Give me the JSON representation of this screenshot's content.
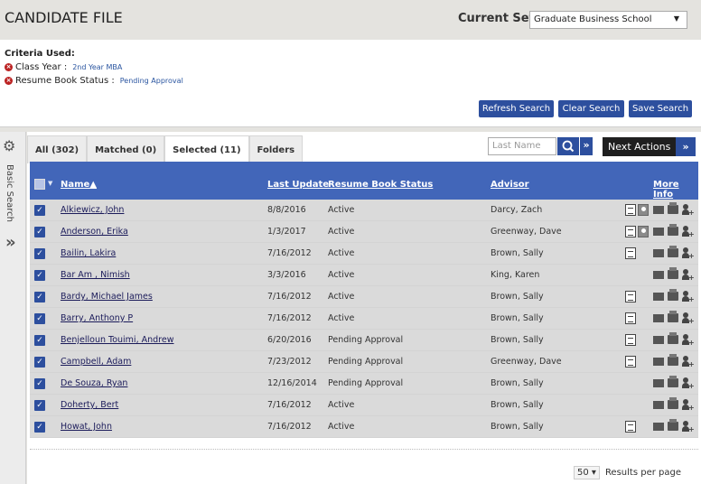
{
  "header": {
    "title": "CANDIDATE FILE",
    "current_set_label": "Current Set:",
    "current_set_value": "Graduate Business School"
  },
  "criteria": {
    "title": "Criteria Used:",
    "items": [
      {
        "label": "Class Year :",
        "value": "2nd Year MBA"
      },
      {
        "label": "Resume Book Status :",
        "value": "Pending Approval"
      }
    ],
    "buttons": {
      "refresh": "Refresh Search",
      "clear": "Clear Search",
      "save": "Save Search"
    }
  },
  "sidebar": {
    "label": "Basic Search"
  },
  "tabs": [
    {
      "label": "All (302)"
    },
    {
      "label": "Matched (0)"
    },
    {
      "label": "Selected (11)"
    },
    {
      "label": "Folders"
    }
  ],
  "toolbar": {
    "search_placeholder": "Last Name",
    "next_actions": "Next Actions"
  },
  "table": {
    "headers": {
      "name": "Name▲",
      "last_update": "Last Update",
      "status": "Resume Book Status",
      "advisor": "Advisor",
      "more_info": "More Info"
    },
    "rows": [
      {
        "name": "Alkiewicz, John",
        "last_update": "8/8/2016",
        "status": "Active",
        "advisor": "Darcy, Zach",
        "resume": true,
        "photo": true
      },
      {
        "name": "Anderson, Erika",
        "last_update": "1/3/2017",
        "status": "Active",
        "advisor": "Greenway, Dave",
        "resume": true,
        "photo": true
      },
      {
        "name": "Bailin, Lakira",
        "last_update": "7/16/2012",
        "status": "Active",
        "advisor": "Brown, Sally",
        "resume": true,
        "photo": false
      },
      {
        "name": "Bar Am , Nimish",
        "last_update": "3/3/2016",
        "status": "Active",
        "advisor": "King, Karen",
        "resume": false,
        "photo": false
      },
      {
        "name": "Bardy, Michael James",
        "last_update": "7/16/2012",
        "status": "Active",
        "advisor": "Brown, Sally",
        "resume": true,
        "photo": false
      },
      {
        "name": "Barry, Anthony P",
        "last_update": "7/16/2012",
        "status": "Active",
        "advisor": "Brown, Sally",
        "resume": true,
        "photo": false
      },
      {
        "name": "Benjelloun Touimi, Andrew",
        "last_update": "6/20/2016",
        "status": "Pending Approval",
        "advisor": "Brown, Sally",
        "resume": true,
        "photo": false
      },
      {
        "name": "Campbell, Adam",
        "last_update": "7/23/2012",
        "status": "Pending Approval",
        "advisor": "Greenway, Dave",
        "resume": true,
        "photo": false
      },
      {
        "name": "De Souza, Ryan",
        "last_update": "12/16/2014",
        "status": "Pending Approval",
        "advisor": "Brown, Sally",
        "resume": false,
        "photo": false
      },
      {
        "name": "Doherty, Bert",
        "last_update": "7/16/2012",
        "status": "Active",
        "advisor": "Brown, Sally",
        "resume": false,
        "photo": false
      },
      {
        "name": "Howat, John",
        "last_update": "7/16/2012",
        "status": "Active",
        "advisor": "Brown, Sally",
        "resume": true,
        "photo": false
      }
    ]
  },
  "pager": {
    "per_page": "50",
    "label": "Results per page"
  }
}
